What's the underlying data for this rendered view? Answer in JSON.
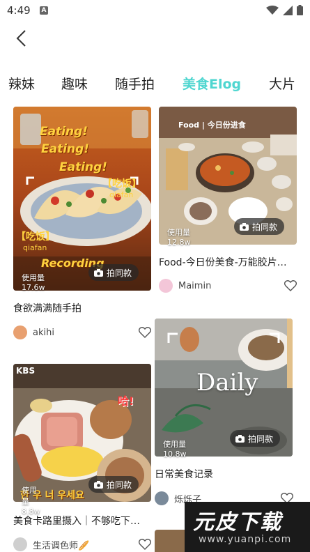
{
  "status": {
    "time": "4:49",
    "app_icon": "A"
  },
  "tabs": [
    {
      "label": "辣妹"
    },
    {
      "label": "趣味"
    },
    {
      "label": "随手拍"
    },
    {
      "label": "美食Elog",
      "active": true
    },
    {
      "label": "大片"
    }
  ],
  "accent_color": "#4fd6d0",
  "cards": {
    "c1": {
      "usage": "使用量 17.6w",
      "button": "拍同款",
      "title": "食欲满满随手拍",
      "author": "akihi",
      "overlay": {
        "eating": "Eating!",
        "recording": "Recording",
        "tag": "【吃饭】",
        "tag_sub": "qiafan"
      }
    },
    "c2": {
      "usage": "使用量 12.8w",
      "button": "拍同款",
      "title": "Food-今日份美食-万能胶片…",
      "author": "Maimin",
      "overlay": {
        "header": "Food | 今日份进食"
      }
    },
    "c3": {
      "usage": "使用量 8.8w",
      "button": "拍同款",
      "title": "美食卡路里摄入｜不够吃下…",
      "author": "生活调色师🥖",
      "overlay": {
        "kbs": "KBS",
        "ha": "哈!",
        "korean": "한 우 너 우세요"
      }
    },
    "c4": {
      "usage": "使用量 10.8w",
      "button": "拍同款",
      "title": "日常美食记录",
      "author": "烁烁子",
      "overlay": {
        "daily": "Daily"
      }
    }
  },
  "watermark": {
    "main": "元皮下载",
    "url": "www.yuanpi.com"
  }
}
